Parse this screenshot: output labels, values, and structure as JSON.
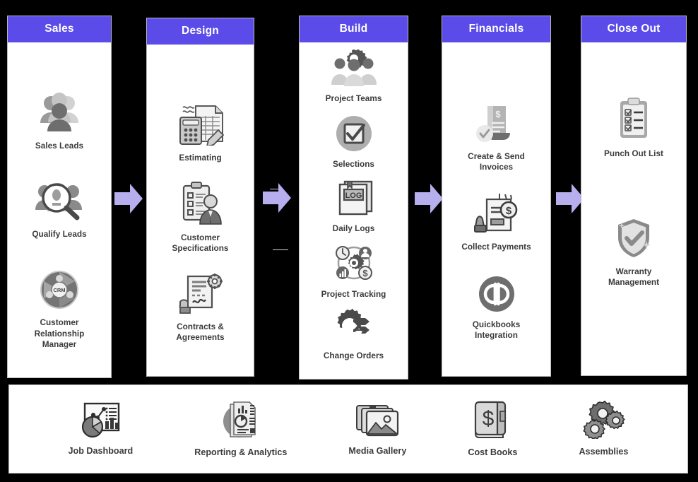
{
  "theme": {
    "header_bg": "#5b4be8",
    "header_text": "#ffffff",
    "arrow_fill": "#b7aeee",
    "panel_bg": "#ffffff",
    "panel_border": "#b9b9b9",
    "page_bg": "#000000",
    "label_text": "#3b3b3b"
  },
  "stages": [
    {
      "title": "Sales",
      "icon": "stage-sales",
      "items": [
        {
          "label": "Sales Leads",
          "icon": "people-group-icon"
        },
        {
          "label": "Qualify Leads",
          "icon": "magnifier-people-icon"
        },
        {
          "label": "Customer\nRelationship\nManager",
          "icon": "crm-circle-icon"
        }
      ]
    },
    {
      "title": "Design",
      "icon": "stage-design",
      "items": [
        {
          "label": "Estimating",
          "icon": "calculator-spreadsheet-icon"
        },
        {
          "label": "Customer\nSpecifications",
          "icon": "clipboard-person-icon"
        },
        {
          "label": "Contracts &\nAgreements",
          "icon": "contract-signature-icon"
        }
      ]
    },
    {
      "title": "Build",
      "icon": "stage-build",
      "items": [
        {
          "label": "Project Teams",
          "icon": "gear-people-icon"
        },
        {
          "label": "Selections",
          "icon": "checkbox-circle-icon"
        },
        {
          "label": "Daily Logs",
          "icon": "log-book-icon"
        },
        {
          "label": "Project Tracking",
          "icon": "gear-tracking-icon"
        },
        {
          "label": "Change Orders",
          "icon": "gear-arrows-icon"
        }
      ]
    },
    {
      "title": "Financials",
      "icon": "stage-financials",
      "items": [
        {
          "label": "Create & Send\nInvoices",
          "icon": "invoice-check-icon"
        },
        {
          "label": "Collect Payments",
          "icon": "payment-stamp-icon"
        },
        {
          "label": "Quickbooks\nIntegration",
          "icon": "quickbooks-icon"
        }
      ]
    },
    {
      "title": "Close Out",
      "icon": "stage-closeout",
      "items": [
        {
          "label": "Punch Out List",
          "icon": "checklist-clipboard-icon"
        },
        {
          "label": "Warranty\nManagement",
          "icon": "shield-check-icon"
        }
      ]
    }
  ],
  "arrows": [
    {
      "name": "arrow-sales-to-design",
      "glyph": "right-arrow-icon"
    },
    {
      "name": "arrow-design-to-build",
      "glyph": "right-arrow-icon"
    },
    {
      "name": "arrow-build-to-financials",
      "glyph": "right-arrow-icon"
    },
    {
      "name": "arrow-financials-to-closeout",
      "glyph": "right-arrow-icon"
    }
  ],
  "bottom_bar": {
    "items": [
      {
        "label": "Job Dashboard",
        "icon": "dashboard-chart-icon"
      },
      {
        "label": "Reporting & Analytics",
        "icon": "reports-analytics-icon"
      },
      {
        "label": "Media Gallery",
        "icon": "media-gallery-icon"
      },
      {
        "label": "Cost Books",
        "icon": "cost-book-icon"
      },
      {
        "label": "Assemblies",
        "icon": "gears-assemblies-icon"
      }
    ]
  }
}
